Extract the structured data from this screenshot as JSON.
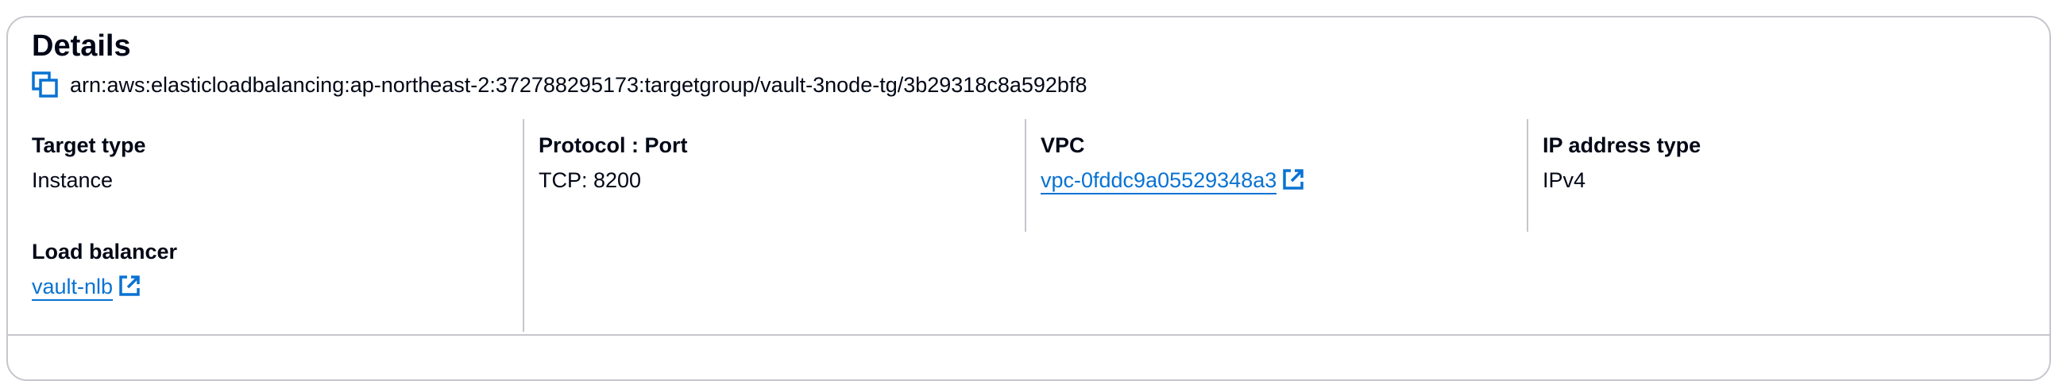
{
  "details": {
    "title": "Details",
    "arn": "arn:aws:elasticloadbalancing:ap-northeast-2:372788295173:targetgroup/vault-3node-tg/3b29318c8a592bf8",
    "copy_icon": "copy-icon"
  },
  "fields": {
    "target_type": {
      "label": "Target type",
      "value": "Instance"
    },
    "protocol_port": {
      "label": "Protocol : Port",
      "value": "TCP: 8200"
    },
    "vpc": {
      "label": "VPC",
      "value": "vpc-0fddc9a05529348a3",
      "icon": "external-link-icon"
    },
    "ip_address_type": {
      "label": "IP address type",
      "value": "IPv4"
    },
    "load_balancer": {
      "label": "Load balancer",
      "value": "vault-nlb",
      "icon": "external-link-icon"
    }
  },
  "colors": {
    "link": "#0972d3",
    "text": "#000716",
    "border": "#c6c6cd"
  }
}
